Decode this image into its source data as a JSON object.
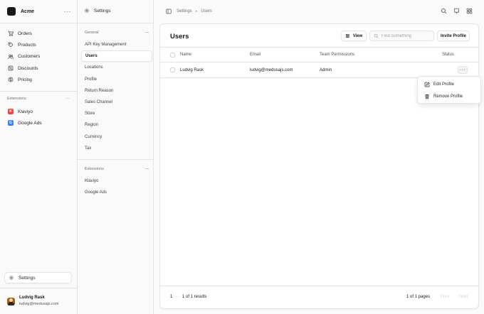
{
  "brand": {
    "name": "Acme",
    "more": "···"
  },
  "nav": {
    "items": [
      {
        "label": "Orders",
        "icon": "cart-icon"
      },
      {
        "label": "Products",
        "icon": "tag-icon"
      },
      {
        "label": "Customers",
        "icon": "users-icon"
      },
      {
        "label": "Discounts",
        "icon": "percent-icon"
      },
      {
        "label": "Pricing",
        "icon": "currency-icon"
      }
    ],
    "extensions_header": "Extensions",
    "extensions_more": "···",
    "extensions": [
      {
        "label": "Klaviyo",
        "color": "#ef4444",
        "glyph": "K"
      },
      {
        "label": "Google Ads",
        "color": "#3b82f6",
        "glyph": "G"
      }
    ],
    "settings_label": "Settings"
  },
  "user": {
    "name": "Ludvig Rask",
    "email": "ludvig@medusajs.com"
  },
  "settings_sidebar": {
    "title": "Settings",
    "general_header": "General",
    "general_more": "···",
    "general_items": [
      "API Key Management",
      "Users",
      "Locations",
      "Profile",
      "Return Reason",
      "Sales Channel",
      "Store",
      "Region",
      "Currency",
      "Tax"
    ],
    "active_item": "Users",
    "extensions_header": "Extensions",
    "extensions_more": "···",
    "extension_items": [
      "Klaviyo",
      "Google Ads"
    ]
  },
  "breadcrumb": {
    "root": "Settings",
    "separator": "▸",
    "current": "Users"
  },
  "page": {
    "title": "Users",
    "view_button": "View",
    "search_placeholder": "Find Something",
    "invite_button": "Invite Profile"
  },
  "table": {
    "columns": [
      "Name",
      "Email",
      "Team Permissions",
      "Status"
    ],
    "rows": [
      {
        "name": "Ludvig Rask",
        "email": "ludvig@medusajs.com",
        "permissions": "Admin",
        "status": ""
      }
    ],
    "row_menu": "···"
  },
  "pagination": {
    "page_size": "1",
    "page_size_more": "···",
    "results": "1 of 1 results",
    "pages": "1 of 1 pages",
    "prev": "Prev",
    "next": "Next"
  },
  "dropdown": {
    "items": [
      {
        "label": "Edit Profile",
        "icon": "edit-icon"
      },
      {
        "label": "Remove Profile",
        "icon": "trash-icon"
      }
    ]
  }
}
